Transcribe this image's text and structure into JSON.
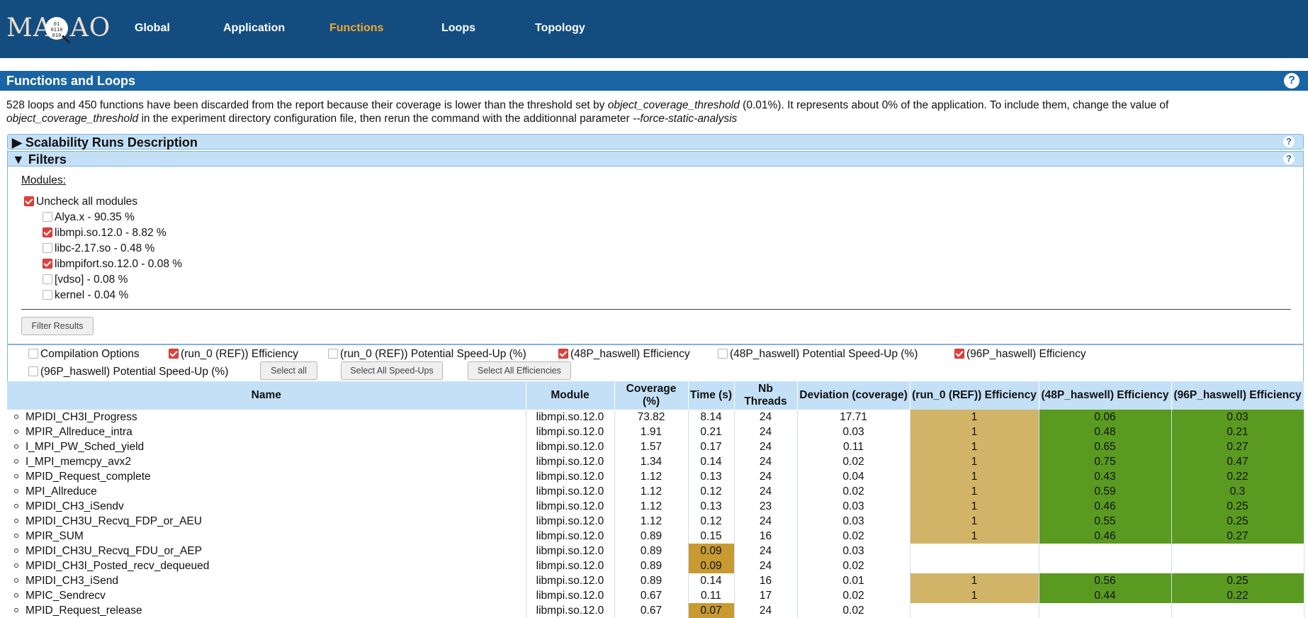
{
  "logo": {
    "text": "MAQAO",
    "inner": "01\n0110\n010"
  },
  "nav": [
    "Global",
    "Application",
    "Functions",
    "Loops",
    "Topology"
  ],
  "section": {
    "title": "Functions and Loops",
    "help": "?"
  },
  "notice": {
    "part1": "528 loops and 450 functions have been discarded from the report because their coverage is lower than the threshold set by ",
    "param1": "object_coverage_threshold",
    "part2": " (0.01%). It represents about 0% of the application. To include them, change the value of ",
    "param2": "object_coverage_threshold",
    "part3": " in the experiment directory configuration file, then rerun the command with the additionnal parameter ",
    "param3": "--force-static-analysis"
  },
  "panels": {
    "scalability": "▶ Scalability Runs Description",
    "filters": "▼ Filters",
    "help": "?"
  },
  "modules": {
    "label": "Modules:",
    "uncheck_all": "Uncheck all modules",
    "items": [
      {
        "label": "Alya.x - 90.35 %",
        "checked": false
      },
      {
        "label": "libmpi.so.12.0 - 8.82 %",
        "checked": true
      },
      {
        "label": "libc-2.17.so - 0.48 %",
        "checked": false
      },
      {
        "label": "libmpifort.so.12.0 - 0.08 %",
        "checked": true
      },
      {
        "label": "[vdso] - 0.08 %",
        "checked": false
      },
      {
        "label": "kernel - 0.04 %",
        "checked": false
      }
    ],
    "filter_button": "Filter Results"
  },
  "columns_options": [
    {
      "label": "Compilation Options",
      "checked": false
    },
    {
      "label": "(run_0 (REF)) Efficiency",
      "checked": true
    },
    {
      "label": "(run_0 (REF)) Potential Speed-Up (%)",
      "checked": false
    },
    {
      "label": "(48P_haswell) Efficiency",
      "checked": true
    },
    {
      "label": "(48P_haswell) Potential Speed-Up (%)",
      "checked": false
    },
    {
      "label": "(96P_haswell) Efficiency",
      "checked": true
    },
    {
      "label": "(96P_haswell) Potential Speed-Up (%)",
      "checked": false
    }
  ],
  "buttons": {
    "select_all": "Select all",
    "select_speedups": "Select All Speed-Ups",
    "select_efficiencies": "Select All Efficiencies"
  },
  "table": {
    "headers": [
      "Name",
      "Module",
      "Coverage (%)",
      "Time (s)",
      "Nb Threads",
      "Deviation (coverage)",
      "(run_0 (REF)) Efficiency",
      "(48P_haswell) Efficiency",
      "(96P_haswell) Efficiency"
    ],
    "rows": [
      [
        "MPIDI_CH3I_Progress",
        "libmpi.so.12.0",
        "73.82",
        "8.14",
        "24",
        "17.71",
        "1",
        "0.06",
        "0.03"
      ],
      [
        "MPIR_Allreduce_intra",
        "libmpi.so.12.0",
        "1.91",
        "0.21",
        "24",
        "0.03",
        "1",
        "0.48",
        "0.21"
      ],
      [
        "I_MPI_PW_Sched_yield",
        "libmpi.so.12.0",
        "1.57",
        "0.17",
        "24",
        "0.11",
        "1",
        "0.65",
        "0.27"
      ],
      [
        "I_MPI_memcpy_avx2",
        "libmpi.so.12.0",
        "1.34",
        "0.14",
        "24",
        "0.02",
        "1",
        "0.75",
        "0.47"
      ],
      [
        "MPID_Request_complete",
        "libmpi.so.12.0",
        "1.12",
        "0.13",
        "24",
        "0.04",
        "1",
        "0.43",
        "0.22"
      ],
      [
        "MPI_Allreduce",
        "libmpi.so.12.0",
        "1.12",
        "0.12",
        "24",
        "0.02",
        "1",
        "0.59",
        "0.3"
      ],
      [
        "MPIDI_CH3_iSendv",
        "libmpi.so.12.0",
        "1.12",
        "0.13",
        "23",
        "0.03",
        "1",
        "0.46",
        "0.25"
      ],
      [
        "MPIDI_CH3U_Recvq_FDP_or_AEU",
        "libmpi.so.12.0",
        "1.12",
        "0.12",
        "24",
        "0.03",
        "1",
        "0.55",
        "0.25"
      ],
      [
        "MPIR_SUM",
        "libmpi.so.12.0",
        "0.89",
        "0.15",
        "16",
        "0.02",
        "1",
        "0.46",
        "0.27"
      ],
      [
        "MPIDI_CH3U_Recvq_FDU_or_AEP",
        "libmpi.so.12.0",
        "0.89",
        "0.09",
        "24",
        "0.03",
        "",
        "",
        ""
      ],
      [
        "MPIDI_CH3I_Posted_recv_dequeued",
        "libmpi.so.12.0",
        "0.89",
        "0.09",
        "24",
        "0.02",
        "",
        "",
        ""
      ],
      [
        "MPIDI_CH3_iSend",
        "libmpi.so.12.0",
        "0.89",
        "0.14",
        "16",
        "0.01",
        "1",
        "0.56",
        "0.25"
      ],
      [
        "MPIC_Sendrecv",
        "libmpi.so.12.0",
        "0.67",
        "0.11",
        "17",
        "0.02",
        "1",
        "0.44",
        "0.22"
      ],
      [
        "MPID_Request_release",
        "libmpi.so.12.0",
        "0.67",
        "0.07",
        "24",
        "0.02",
        "",
        "",
        ""
      ]
    ],
    "highlight_time_rows": [
      9,
      10,
      13
    ]
  }
}
